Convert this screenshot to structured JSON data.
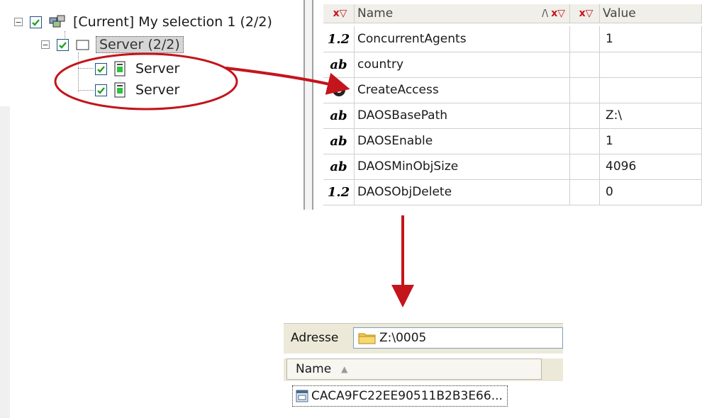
{
  "tree": {
    "root_label": "[Current] My selection 1  (2/2)",
    "group_label": "Server  (2/2)",
    "children": [
      {
        "label": "Server"
      },
      {
        "label": "Server"
      }
    ]
  },
  "grid": {
    "columns": {
      "name": "Name",
      "value": "Value"
    },
    "rows": [
      {
        "type": "1.2",
        "name": "ConcurrentAgents",
        "value": "1"
      },
      {
        "type": "ab",
        "name": "country",
        "value": ""
      },
      {
        "type": "icon",
        "name": "CreateAccess",
        "value": ""
      },
      {
        "type": "ab",
        "name": "DAOSBasePath",
        "value": "Z:\\"
      },
      {
        "type": "ab",
        "name": "DAOSEnable",
        "value": "1"
      },
      {
        "type": "ab",
        "name": "DAOSMinObjSize",
        "value": "4096"
      },
      {
        "type": "1.2",
        "name": "DAOSObjDelete",
        "value": "0"
      }
    ]
  },
  "explorer": {
    "address_label": "Adresse",
    "address_value": "Z:\\0005",
    "column_name": "Name",
    "file_name": "CACA9FC22EE90511B2B3E66..."
  },
  "colors": {
    "annotation": "#c4141c",
    "checkbox": "#1c5180",
    "folder": "#f2c94c"
  }
}
